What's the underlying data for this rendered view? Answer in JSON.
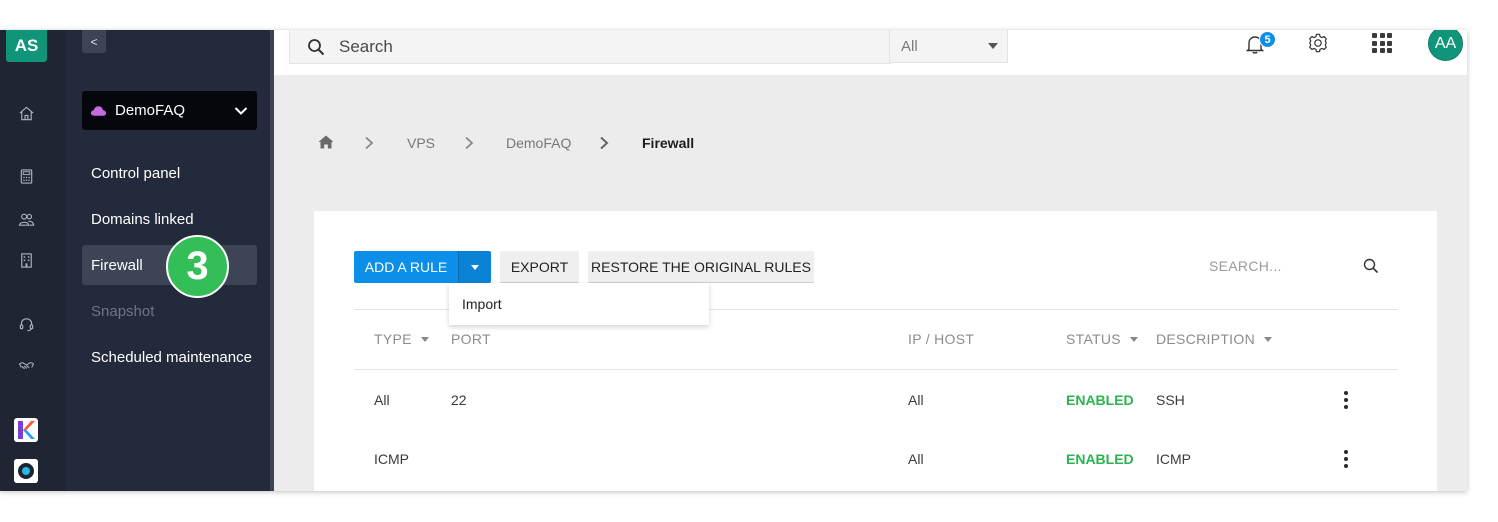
{
  "rail": {
    "logo": "AS",
    "icons": [
      "home-icon",
      "calculator-icon",
      "users-icon",
      "building-icon",
      "headset-icon",
      "handshake-icon"
    ],
    "apps": [
      "k-app-icon",
      "o-app-icon"
    ]
  },
  "panel": {
    "collapse_label": "<",
    "project_name": "DemoFAQ",
    "items": [
      {
        "label": "Control panel"
      },
      {
        "label": "Domains linked"
      },
      {
        "label": "Firewall"
      },
      {
        "label": "Snapshot"
      },
      {
        "label": "Scheduled maintenance"
      }
    ],
    "step_badge": "3"
  },
  "topbar": {
    "search_placeholder": "Search",
    "scope_value": "All",
    "notifications_count": "5",
    "avatar_initials": "AA"
  },
  "breadcrumb": {
    "items": [
      "VPS",
      "DemoFAQ",
      "Firewall"
    ]
  },
  "toolbar": {
    "add_rule_label": "ADD A RULE",
    "export_label": "EXPORT",
    "restore_label": "RESTORE THE ORIGINAL RULES",
    "dropdown_item": "Import",
    "search_placeholder": "SEARCH..."
  },
  "table": {
    "headers": {
      "type": "TYPE",
      "port": "PORT",
      "ip": "IP / HOST",
      "status": "STATUS",
      "description": "DESCRIPTION"
    },
    "rows": [
      {
        "type": "All",
        "port": "22",
        "ip": "All",
        "status": "ENABLED",
        "description": "SSH"
      },
      {
        "type": "ICMP",
        "port": "",
        "ip": "All",
        "status": "ENABLED",
        "description": "ICMP"
      }
    ]
  },
  "colors": {
    "accent_blue": "#0b8fe8",
    "brand_green": "#11957a",
    "status_enabled": "#2bb350",
    "sidebar_bg": "#232a3b"
  }
}
